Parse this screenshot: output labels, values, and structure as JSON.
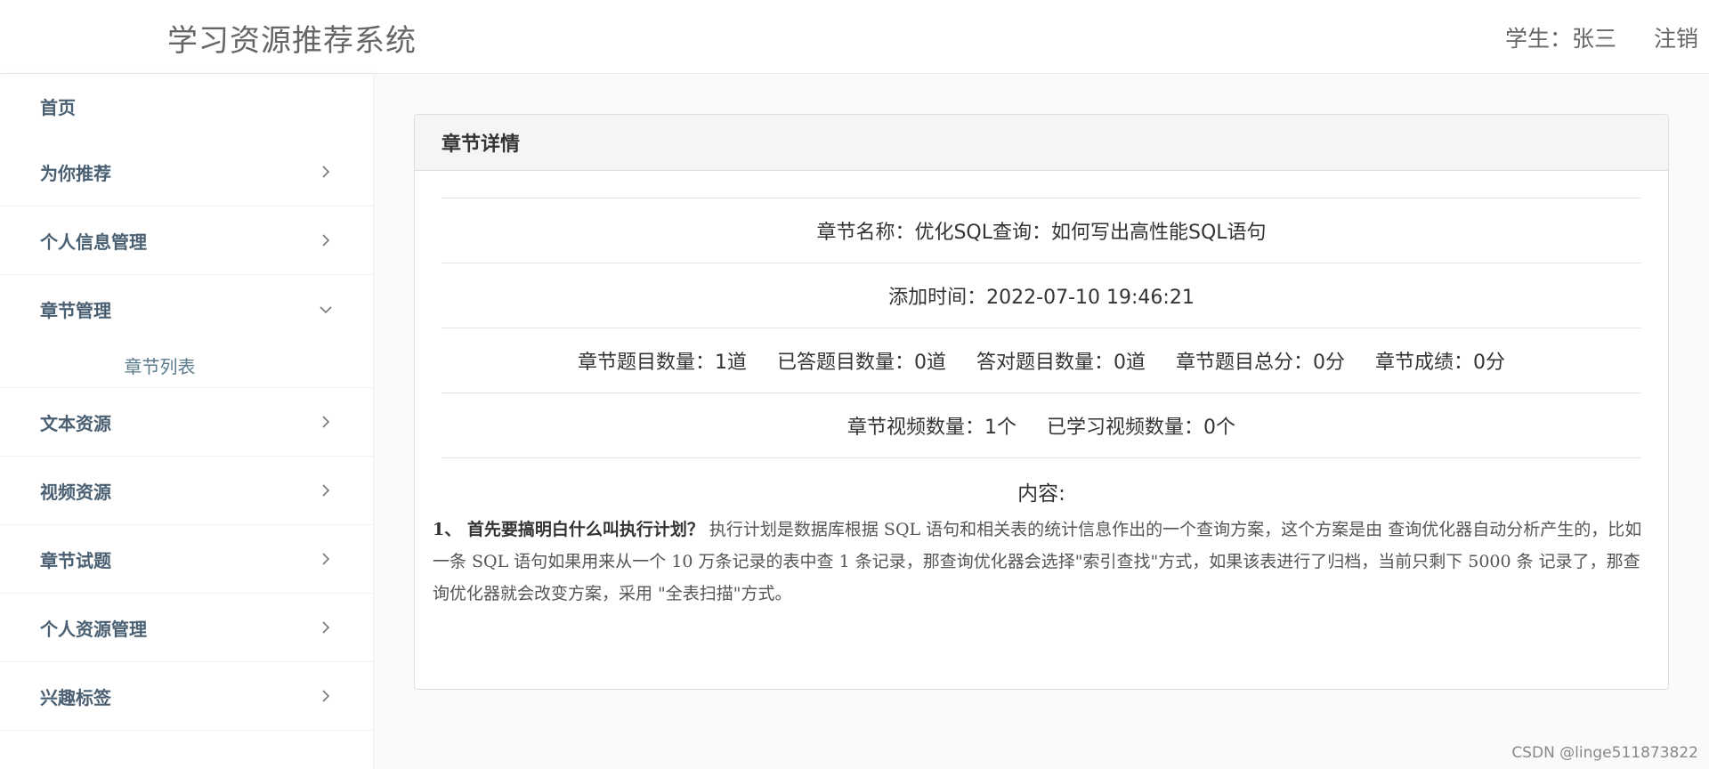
{
  "header": {
    "app_title": "学习资源推荐系统",
    "user_label": "学生：张三",
    "logout_label": "注销"
  },
  "sidebar": {
    "items": [
      {
        "label": "首页",
        "has_arrow": false
      },
      {
        "label": "为你推荐",
        "has_arrow": true
      },
      {
        "label": "个人信息管理",
        "has_arrow": true
      },
      {
        "label": "章节管理",
        "has_arrow": true,
        "expanded": true,
        "sub_items": [
          "章节列表"
        ]
      },
      {
        "label": "文本资源",
        "has_arrow": true
      },
      {
        "label": "视频资源",
        "has_arrow": true
      },
      {
        "label": "章节试题",
        "has_arrow": true
      },
      {
        "label": "个人资源管理",
        "has_arrow": true
      },
      {
        "label": "兴趣标签",
        "has_arrow": true
      }
    ]
  },
  "card": {
    "title": "章节详情",
    "chapter_name": "章节名称：优化SQL查询：如何写出高性能SQL语句",
    "added_time": "添加时间：2022-07-10 19:46:21",
    "stats": {
      "question_count": "章节题目数量：1道",
      "answered_count": "已答题目数量：0道",
      "correct_count": "答对题目数量：0道",
      "total_score": "章节题目总分：0分",
      "chapter_score": "章节成绩：0分"
    },
    "videos": {
      "video_count": "章节视频数量：1个",
      "studied_count": "已学习视频数量：0个"
    },
    "content_label": "内容:",
    "content_lead": "1、 首先要搞明白什么叫执行计划？",
    "content_body": " 执行计划是数据库根据 SQL 语句和相关表的统计信息作出的一个查询方案，这个方案是由 查询优化器自动分析产生的，比如一条 SQL 语句如果用来从一个 10 万条记录的表中查 1 条记录，那查询优化器会选择\"索引查找\"方式，如果该表进行了归档，当前只剩下 5000 条 记录了，那查询优化器就会改变方案，采用 \"全表扫描\"方式。"
  },
  "watermark": "CSDN @linge511873822",
  "colors": {
    "nav_text": "#4a6072",
    "sub_text": "#5a7a8c",
    "header_bg": "#f5f5f5",
    "border": "#dcdfe6"
  },
  "icons": {
    "collapsed": "chevron-right-icon",
    "expanded": "chevron-down-icon"
  }
}
